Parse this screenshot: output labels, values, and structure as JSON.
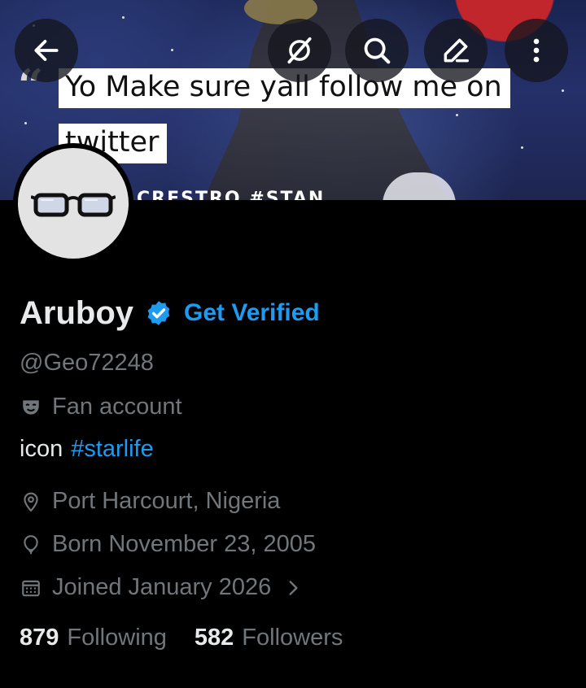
{
  "banner": {
    "caption_line1": "Yo Make sure yall follow me on",
    "caption_line2": "twitter",
    "caption_cut": "CRESTRO #STAN"
  },
  "topbar": {
    "buttons": [
      "back-arrow-icon",
      "grok-icon",
      "search-icon",
      "edit-icon",
      "more-vertical-icon"
    ]
  },
  "profile": {
    "name": "Aruboy",
    "get_verified": "Get Verified",
    "handle": "@Geo72248",
    "category": "Fan account",
    "bio_text": "icon",
    "bio_hashtag": "#starlife",
    "location": "Port Harcourt, Nigeria",
    "birthday": "Born November 23, 2005",
    "joined": "Joined January 2026",
    "following_count": "879",
    "following_label": "Following",
    "followers_count": "582",
    "followers_label": "Followers"
  },
  "colors": {
    "accent": "#1d9bf0",
    "muted": "#71767b",
    "text": "#e7e9ea",
    "background": "#000000"
  }
}
